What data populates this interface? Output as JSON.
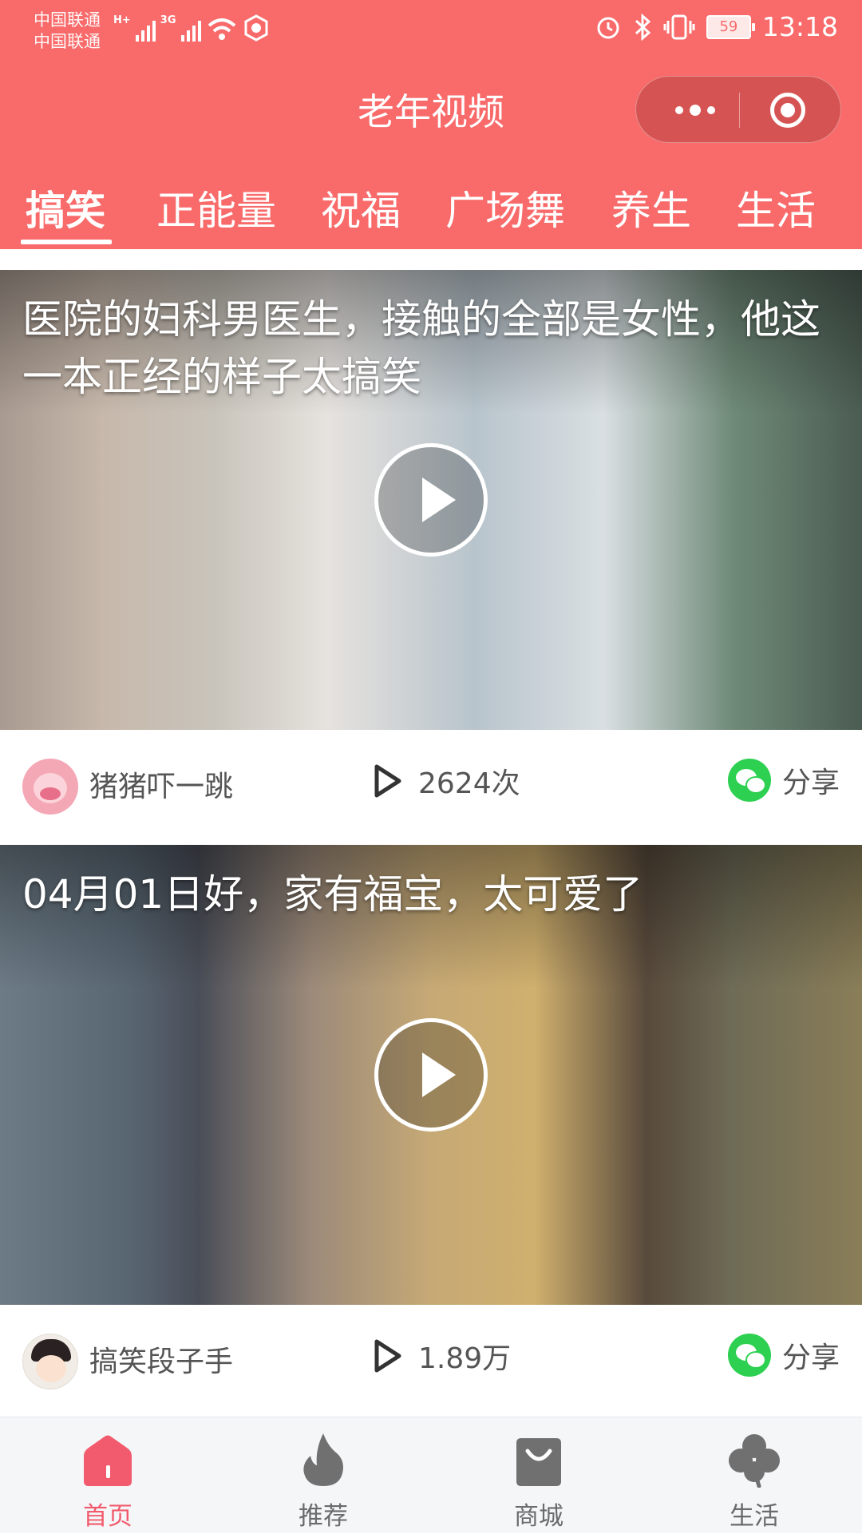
{
  "status_bar": {
    "carrier_1": "中国联通",
    "carrier_2": "中国联通",
    "net_1": "H+",
    "net_2": "3G",
    "battery": "59",
    "time": "13:18"
  },
  "header": {
    "title": "老年视频",
    "capsule_icons": [
      "more-dots-icon",
      "close-target-icon"
    ],
    "background_color": "#f96a6a"
  },
  "tabs": [
    {
      "label": "搞笑",
      "active": true
    },
    {
      "label": "正能量",
      "active": false
    },
    {
      "label": "祝福",
      "active": false
    },
    {
      "label": "广场舞",
      "active": false
    },
    {
      "label": "养生",
      "active": false
    },
    {
      "label": "生活",
      "active": false
    }
  ],
  "feed": [
    {
      "title": "医院的妇科男医生，接触的全部是女性，他这一本正经的样子太搞笑",
      "author": "猪猪吓一跳",
      "views": "2624次",
      "share_label": "分享"
    },
    {
      "title": "04月01日好，家有福宝，太可爱了",
      "author": "搞笑段子手",
      "views": "1.89万",
      "share_label": "分享"
    }
  ],
  "tabbar": [
    {
      "label": "首页",
      "icon": "home-icon",
      "active": true
    },
    {
      "label": "推荐",
      "icon": "flame-icon",
      "active": false
    },
    {
      "label": "商城",
      "icon": "shopping-bag-icon",
      "active": false
    },
    {
      "label": "生活",
      "icon": "clover-icon",
      "active": false
    }
  ],
  "colors": {
    "accent": "#f96a6a",
    "active_tab": "#f25b6d",
    "wechat_green": "#2ed052"
  }
}
